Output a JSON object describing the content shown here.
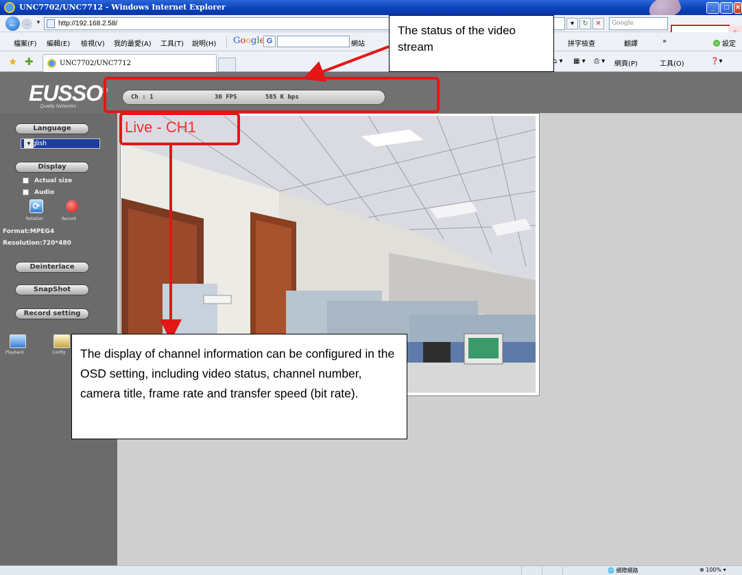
{
  "window": {
    "title": "UNC7702/UNC7712 - Windows Internet Explorer",
    "url": "http://192.168.2.58/",
    "search_placeholder": "Google",
    "tab_title": "UNC7702/UNC7712"
  },
  "menu": {
    "items": [
      "檔案(F)",
      "編輯(E)",
      "檢視(V)",
      "我的最愛(A)",
      "工具(T)",
      "說明(H)"
    ],
    "toolbar_right": [
      "拼字檢查",
      "翻譯",
      "»",
      "設定"
    ],
    "google_go": "G",
    "go_label": "網站"
  },
  "command_bar": {
    "items": [
      "網頁(P)",
      "工具(O)"
    ]
  },
  "brand": {
    "logo": "EUSSO",
    "registered": "®",
    "tagline": "Quality Networks"
  },
  "stream_status": {
    "channel": "Ch : 1",
    "fps": "30 FPS",
    "bitrate": "585 K bps"
  },
  "sidebar": {
    "language_button": "Language",
    "language_value": "English",
    "display_button": "Display",
    "actual_size_label": "Actual size",
    "audio_label": "Audio",
    "rotation_label": "Rotation",
    "record_label": "Record",
    "format": "Format:MPEG4",
    "resolution": "Resolution:720*480",
    "deinterlace_button": "Deinterlace",
    "snapshot_button": "SnapShot",
    "record_setting_button": "Record setting",
    "playback_label": "Playback",
    "config_label": "Config"
  },
  "video": {
    "osd_text": "Live -   CH1"
  },
  "annotations": {
    "top_callout": "The status of the video stream",
    "bottom_callout": "The display of channel information can be configured in the OSD setting, including video status, channel number, camera title, frame rate and transfer speed (bit rate)."
  },
  "statusbar": {
    "zone": "網際網路",
    "zoom": "100%"
  },
  "colors": {
    "annotation_red": "#e41616",
    "osd_red": "#ff2a2a",
    "sidebar_gray": "#6b6b6b",
    "ie_blue": "#0a3fb8"
  }
}
